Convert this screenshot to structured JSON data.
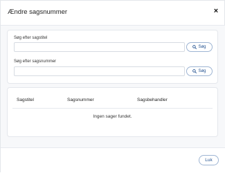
{
  "dialog": {
    "title": "Ændre sagsnummer",
    "close_symbol": "×"
  },
  "search": {
    "title_field": {
      "label": "Søg efter sagstitel",
      "value": "",
      "button_label": "Søg",
      "button_icon": "search-icon"
    },
    "number_field": {
      "label": "Søg efter sagsnummer",
      "value": "",
      "button_label": "Søg",
      "button_icon": "search-icon"
    }
  },
  "results": {
    "columns": [
      "Sagstitel",
      "Sagsnummer",
      "Sagsbehandler"
    ],
    "rows": [],
    "empty_message": "Ingen sager fundet."
  },
  "footer": {
    "close_label": "Luk"
  },
  "colors": {
    "accent": "#1f4f8f",
    "button_border": "#9db4d3",
    "body_background": "#f7f8fa"
  }
}
